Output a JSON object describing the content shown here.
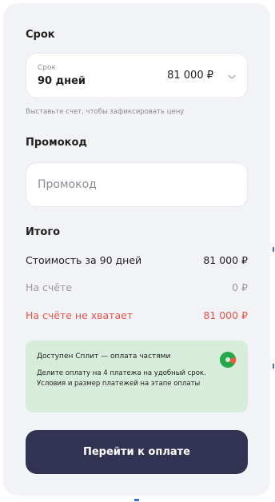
{
  "term": {
    "section_title": "Срок",
    "select_small_label": "Срок",
    "select_value": "90 дней",
    "select_price": "81 000 ₽",
    "hint": "Выставьте счет, чтобы зафиксировать цену"
  },
  "promo": {
    "section_title": "Промокод",
    "placeholder": "Промокод"
  },
  "total": {
    "section_title": "Итого",
    "rows": [
      {
        "label": "Стоимость за 90 дней",
        "value": "81 000 ₽"
      },
      {
        "label": "На счёте",
        "value": "0 ₽"
      },
      {
        "label": "На счёте не хватает",
        "value": "81 000 ₽"
      }
    ]
  },
  "split": {
    "title": "Доступен Сплит — оплата частями",
    "text": "Делите оплату на 4 платежа на удобный срок. Условия и размер платежей на этапе оплаты",
    "logo_icon": "split-logo-icon"
  },
  "pay_button_label": "Перейти к оплате",
  "colors": {
    "panel": "#f2f3f6",
    "button": "#323253",
    "danger": "#e5534b",
    "split_bg": "#d8ecdc"
  }
}
